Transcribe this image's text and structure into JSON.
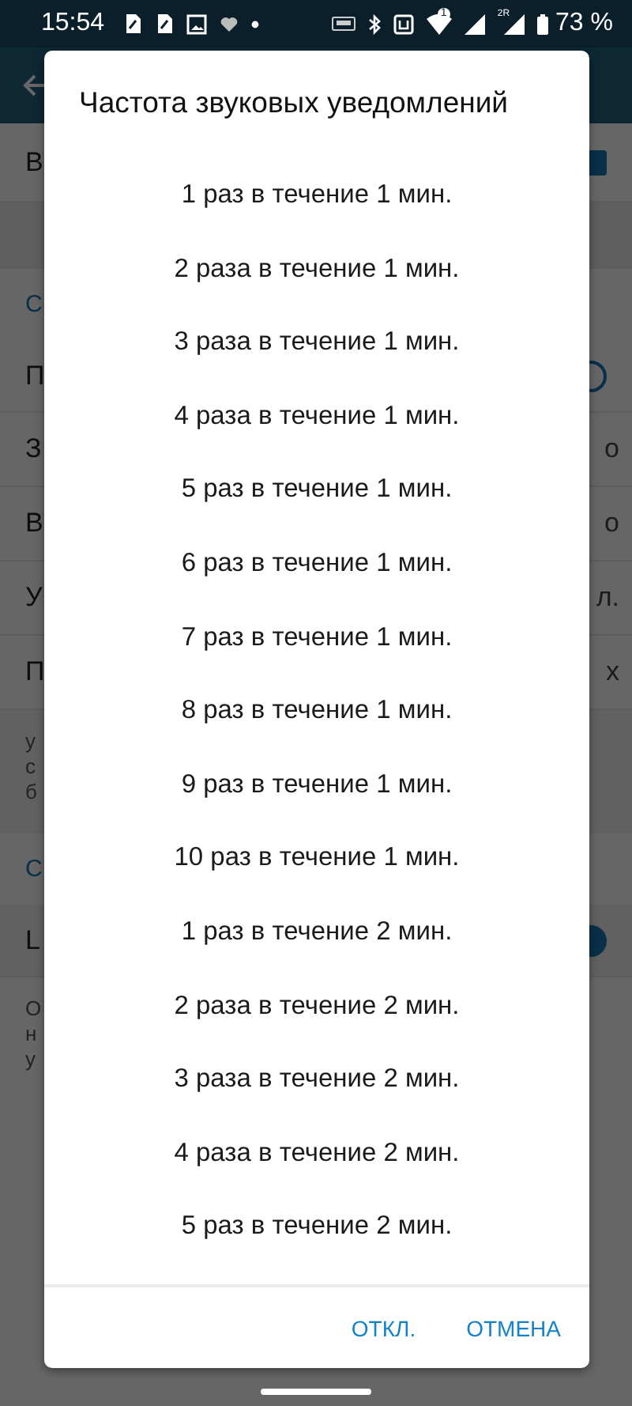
{
  "status_bar": {
    "time": "15:54",
    "battery": "73 %",
    "sim_badge": "1",
    "network_label": "2R"
  },
  "background": {
    "rows": [
      {
        "kind": "checkbox",
        "left": "В",
        "checked": true
      },
      {
        "kind": "band"
      },
      {
        "kind": "section",
        "left": "С"
      },
      {
        "kind": "toggle",
        "left": "П",
        "on": false
      },
      {
        "kind": "value",
        "left": "З",
        "right": "о"
      },
      {
        "kind": "value",
        "left": "В",
        "right": "о"
      },
      {
        "kind": "value",
        "left": "У",
        "right": "л."
      },
      {
        "kind": "value",
        "left": "П",
        "right": "х"
      },
      {
        "kind": "note",
        "lines": [
          "у",
          "с",
          "б"
        ]
      },
      {
        "kind": "section",
        "left": "С"
      },
      {
        "kind": "toggle",
        "left": "L",
        "on": true
      },
      {
        "kind": "plain",
        "lines": [
          "О",
          "н",
          "у"
        ]
      }
    ]
  },
  "dialog": {
    "title": "Частота звуковых уведомлений",
    "options": [
      "1 раз в течение 1 мин.",
      "2 раза в течение 1 мин.",
      "3 раза в течение 1 мин.",
      "4 раза в течение 1 мин.",
      "5 раз в течение 1 мин.",
      "6 раз в течение 1 мин.",
      "7 раз в течение 1 мин.",
      "8 раз в течение 1 мин.",
      "9 раз в течение 1 мин.",
      "10 раз в течение 1 мин.",
      "1 раз в течение 2 мин.",
      "2 раза в течение 2 мин.",
      "3 раза в течение 2 мин.",
      "4 раза в течение 2 мин.",
      "5 раз в течение 2 мин."
    ],
    "buttons": [
      "ОТКЛ.",
      "ОТМЕНА"
    ]
  }
}
